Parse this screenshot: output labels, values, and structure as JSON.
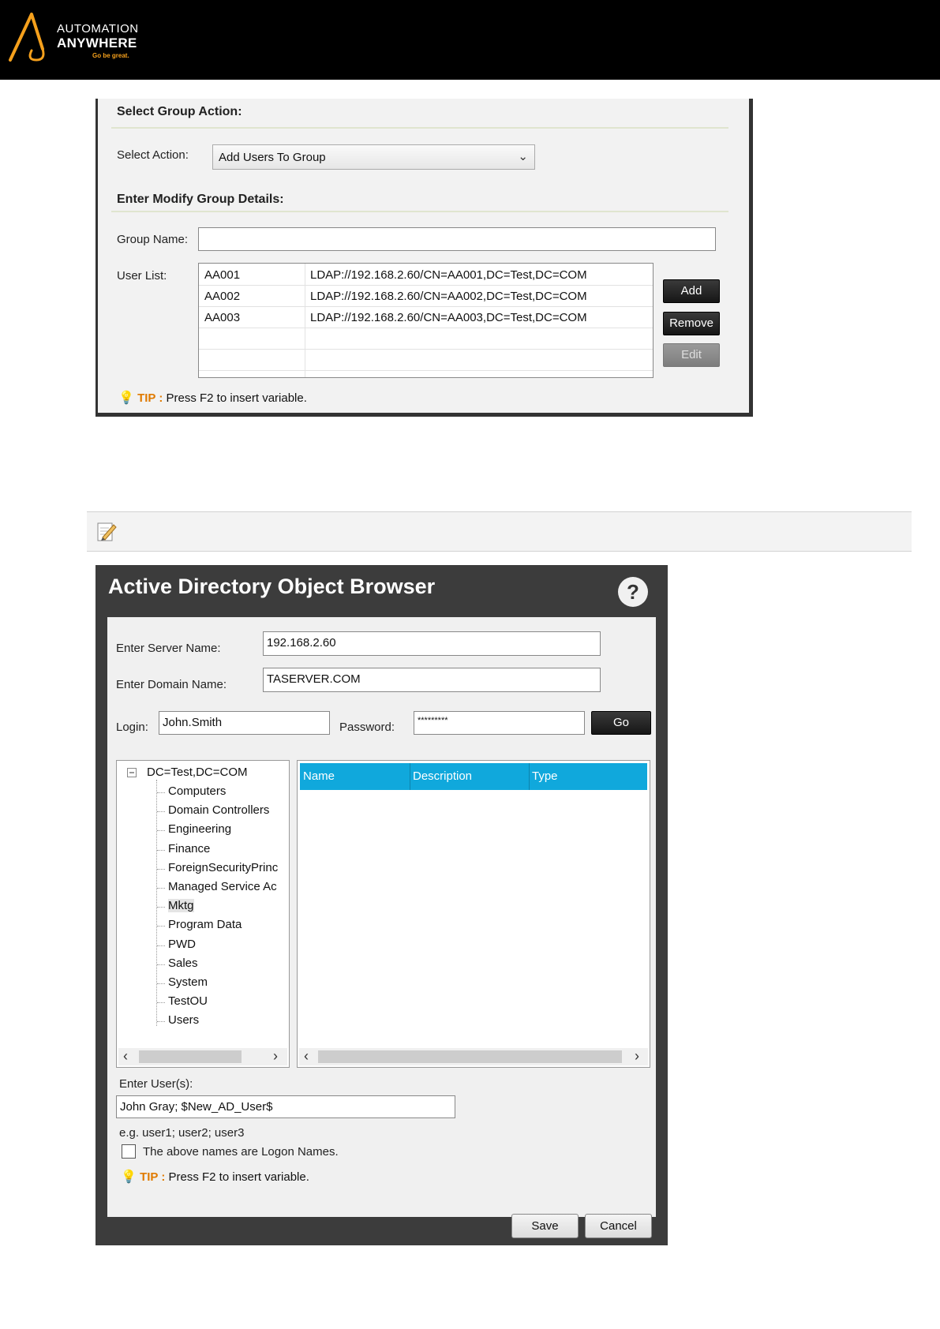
{
  "brand": {
    "line1": "AUTOMATION",
    "line2": "ANYWHERE",
    "tagline": "Go be great."
  },
  "group_panel": {
    "section1_title": "Select Group Action:",
    "select_action_label": "Select Action:",
    "select_action_value": "Add Users To Group",
    "section2_title": "Enter Modify Group Details:",
    "group_name_label": "Group Name:",
    "group_name_value": "",
    "user_list_label": "User List:",
    "users": [
      {
        "id": "AA001",
        "path": "LDAP://192.168.2.60/CN=AA001,DC=Test,DC=COM"
      },
      {
        "id": "AA002",
        "path": "LDAP://192.168.2.60/CN=AA002,DC=Test,DC=COM"
      },
      {
        "id": "AA003",
        "path": "LDAP://192.168.2.60/CN=AA003,DC=Test,DC=COM"
      }
    ],
    "buttons": {
      "add": "Add",
      "remove": "Remove",
      "edit": "Edit"
    },
    "tip_label": "TIP :",
    "tip_text": "Press F2 to insert variable."
  },
  "ad_browser": {
    "title": "Active Directory Object Browser",
    "help": "?",
    "server_label": "Enter Server Name:",
    "server_value": "192.168.2.60",
    "domain_label": "Enter Domain Name:",
    "domain_value": "TASERVER.COM",
    "login_label": "Login:",
    "login_value": "John.Smith",
    "password_label": "Password:",
    "password_value": "*********",
    "go_label": "Go",
    "tree_root": "DC=Test,DC=COM",
    "tree_items": [
      "Computers",
      "Domain Controllers",
      "Engineering",
      "Finance",
      "ForeignSecurityPrinc",
      "Managed Service Ac",
      "Mktg",
      "Program Data",
      "PWD",
      "Sales",
      "System",
      "TestOU",
      "Users"
    ],
    "tree_selected": "Mktg",
    "columns": [
      "Name",
      "Description",
      "Type"
    ],
    "enter_users_label": "Enter User(s):",
    "enter_users_value": "John Gray; $New_AD_User$",
    "example_text": "e.g. user1; user2; user3",
    "checkbox_label": "The above names are Logon Names.",
    "checkbox_checked": false,
    "tip_label": "TIP :",
    "tip_text": "Press F2 to insert variable.",
    "save_label": "Save",
    "cancel_label": "Cancel"
  }
}
